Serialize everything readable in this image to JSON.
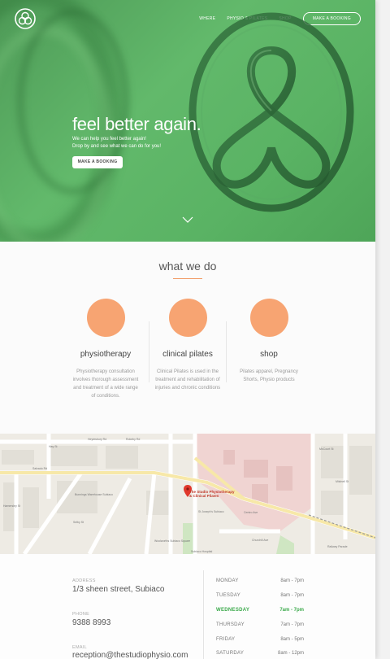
{
  "nav": {
    "items": [
      {
        "label": "WHERE"
      },
      {
        "label": "PHYSIO & PILATES"
      },
      {
        "label": "SHOP"
      }
    ],
    "booking_label": "MAKE A BOOKING"
  },
  "hero": {
    "title": "feel better again.",
    "subtitle_line1": "We can help you feel better again!",
    "subtitle_line2": "Drop by and see what we can do for you!",
    "cta_label": "MAKE A BOOKING",
    "accent": "#5cb366"
  },
  "what_we_do": {
    "title": "what we do",
    "services": [
      {
        "name": "physiotherapy",
        "desc": "Physiotherapy consultation involves thorough assessment and treatment of a wide range of conditions."
      },
      {
        "name": "clinical pilates",
        "desc": "Clinical Pilates is used in the treatment and rehabilitation of injuries and chronic conditions"
      },
      {
        "name": "shop",
        "desc": "Pilates apparel, Pregnancy Shorts, Physio products"
      }
    ],
    "accent": "#f7a472"
  },
  "map": {
    "marker_label_1": "The Studio Physiotherapy",
    "marker_label_2": "& Clinical Pilates",
    "streets": [
      "Heytesbury Rd",
      "Hay St",
      "Salvado Rd",
      "Rokeby Rd",
      "Hamersley St",
      "Railway Parade",
      "Churchill Ave",
      "Selby St",
      "Centro Ave",
      "St Joseph's Subiaco",
      "Subiaco Hospital",
      "Woolworths Subiaco Square",
      "Bunnings Warehouse Subiaco",
      "Mitchell St",
      "McCourt St"
    ]
  },
  "contact": {
    "address_label": "ADDRESS",
    "address": "1/3 sheen street, Subiaco",
    "phone_label": "PHONE",
    "phone": "9388 8993",
    "email_label": "EMAIL",
    "email": "reception@thestudiophysio.com"
  },
  "hours": [
    {
      "day": "MONDAY",
      "time": "8am - 7pm",
      "today": false
    },
    {
      "day": "TUESDAY",
      "time": "8am - 7pm",
      "today": false
    },
    {
      "day": "WEDNESDAY",
      "time": "7am - 7pm",
      "today": true
    },
    {
      "day": "THURSDAY",
      "time": "7am - 7pm",
      "today": false
    },
    {
      "day": "FRIDAY",
      "time": "8am - 5pm",
      "today": false
    },
    {
      "day": "SATURDAY",
      "time": "8am - 12pm",
      "today": false
    }
  ]
}
